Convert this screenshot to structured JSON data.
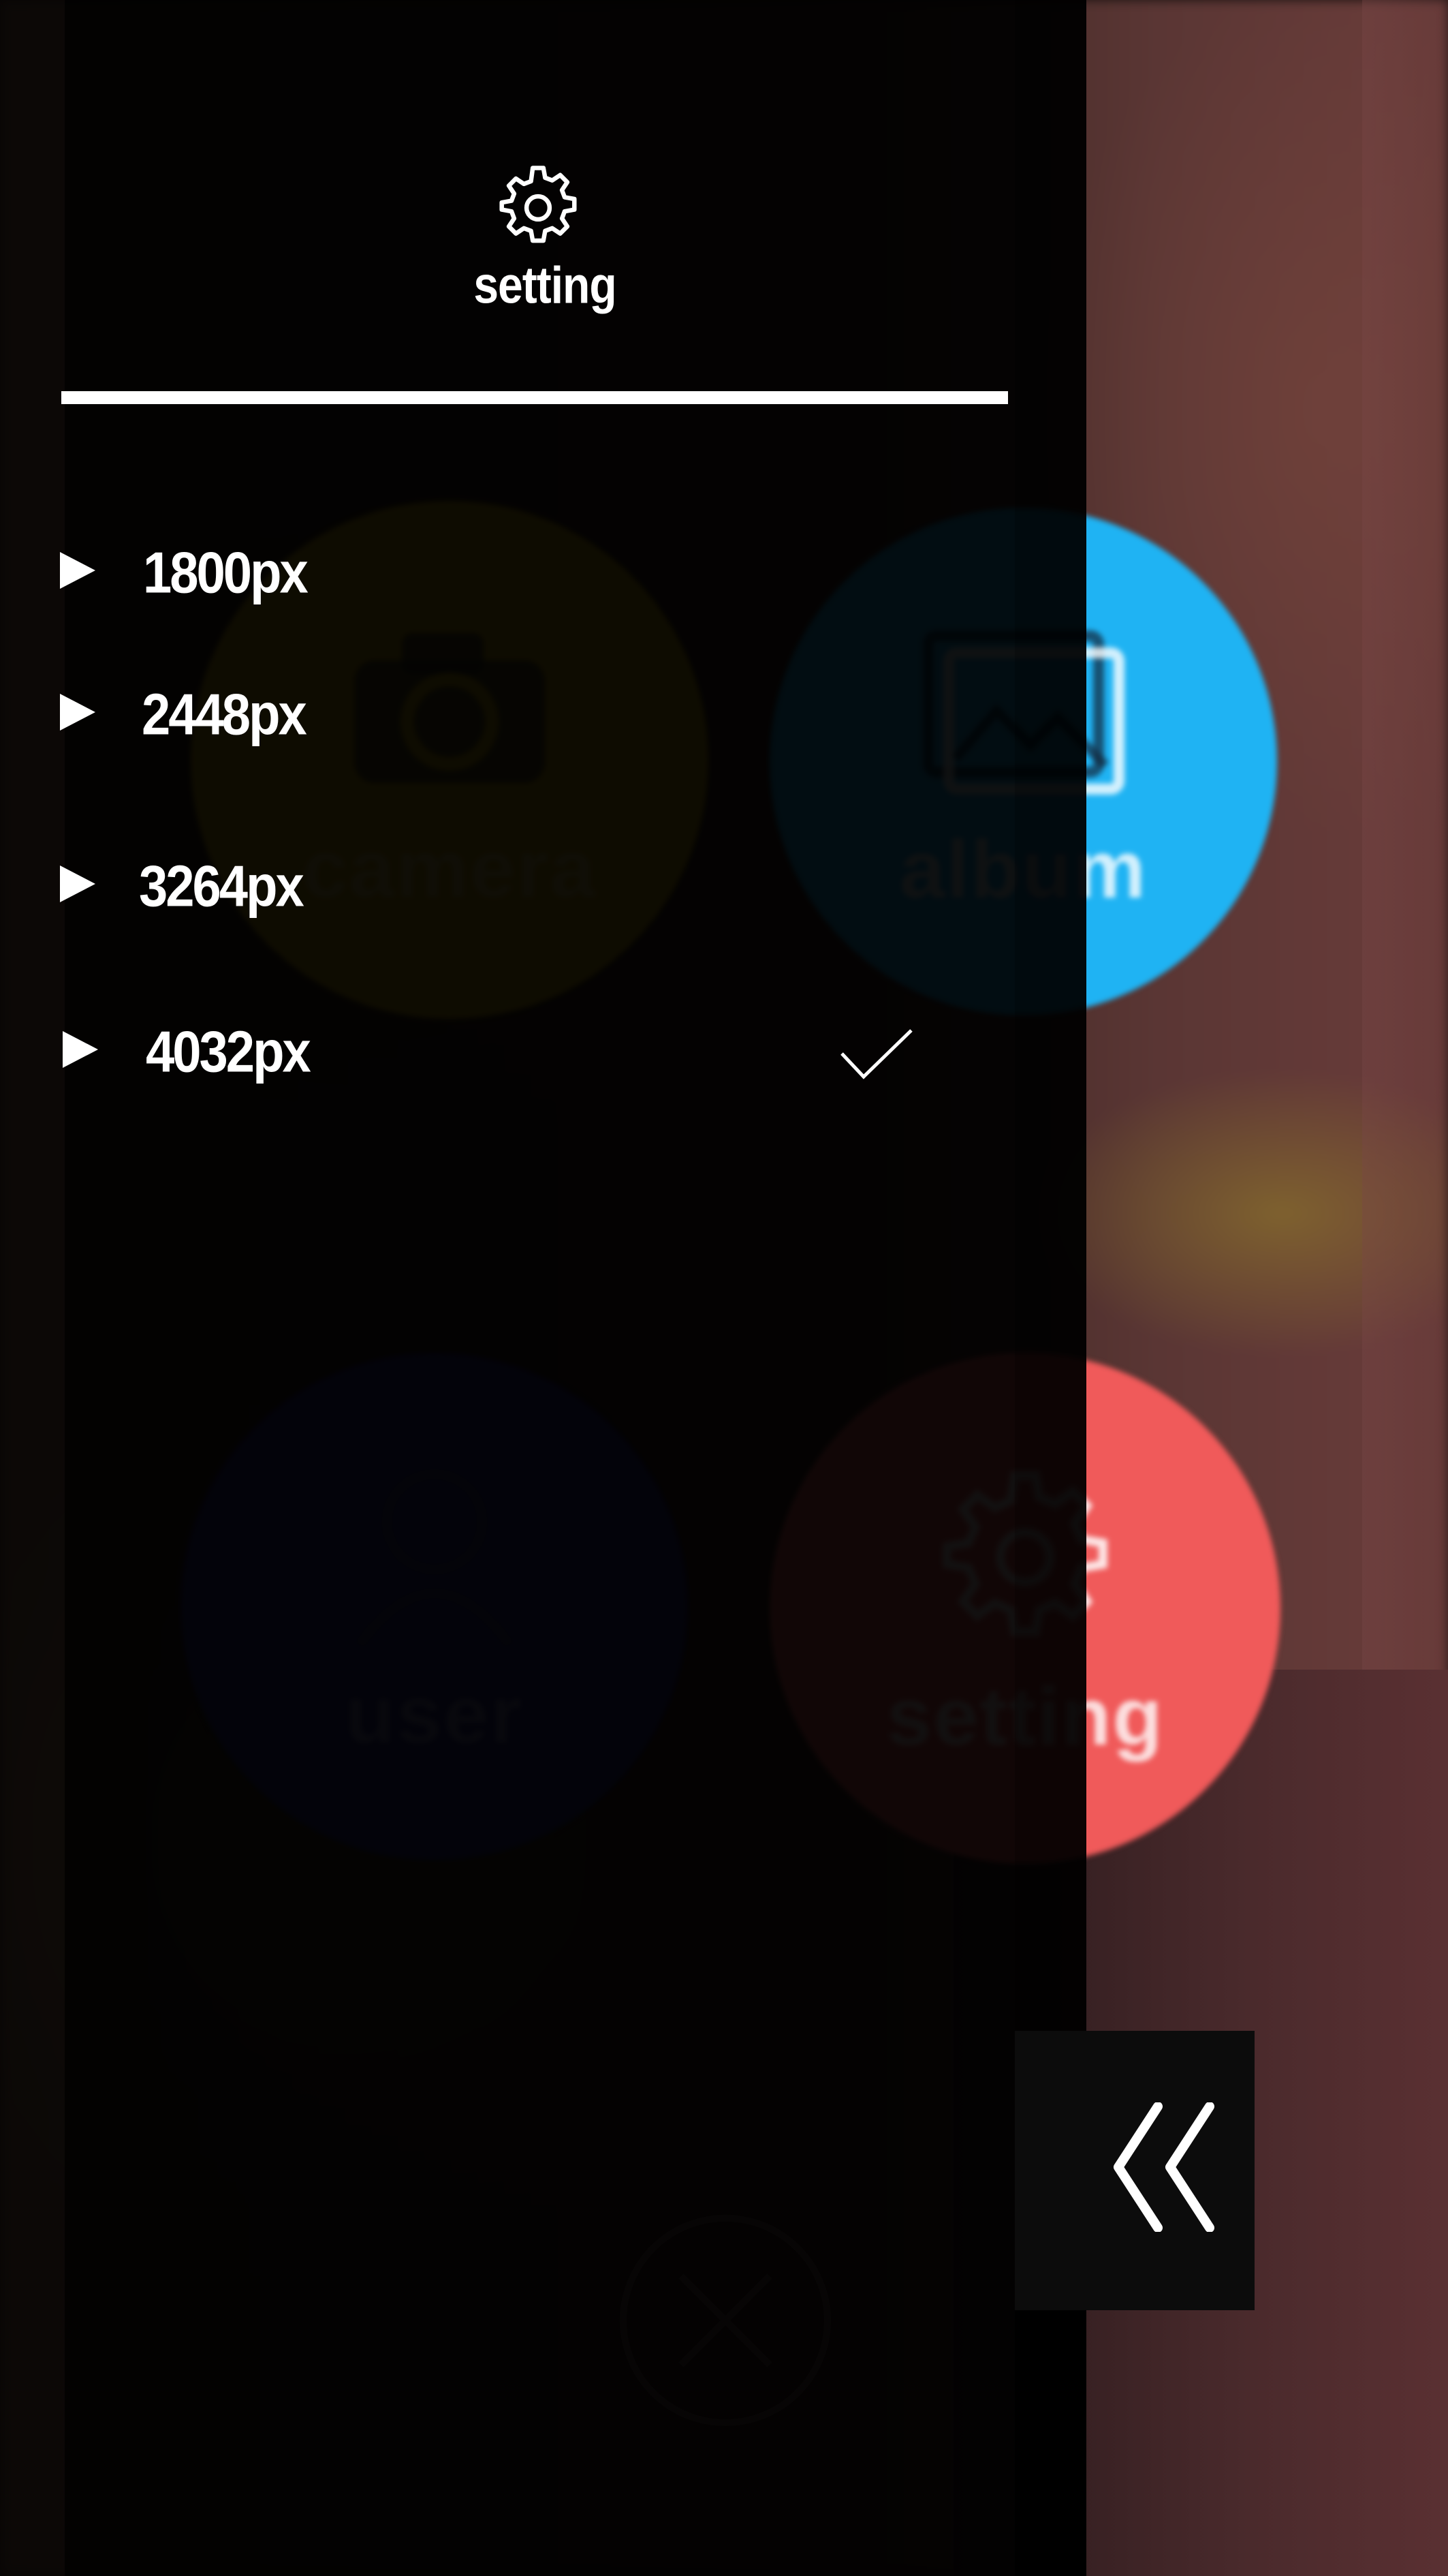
{
  "background_menu": {
    "camera_label": "camera",
    "album_label": "album",
    "user_label": "user",
    "setting_label": "setting"
  },
  "panel": {
    "title": "setting",
    "header_icon": "gear-icon",
    "resolutions": [
      {
        "label": "1800px",
        "selected": false
      },
      {
        "label": "2448px",
        "selected": false
      },
      {
        "label": "3264px",
        "selected": false
      },
      {
        "label": "4032px",
        "selected": true
      }
    ]
  },
  "icons": {
    "back": "double-chevron-left-icon",
    "close": "close-icon",
    "check": "checkmark-icon"
  },
  "colors": {
    "camera": "#c9a70e",
    "album": "#1fb3f3",
    "user": "#2a2a8a",
    "setting": "#f05a5a",
    "panel": "#000000",
    "foreground": "#ffffff"
  }
}
